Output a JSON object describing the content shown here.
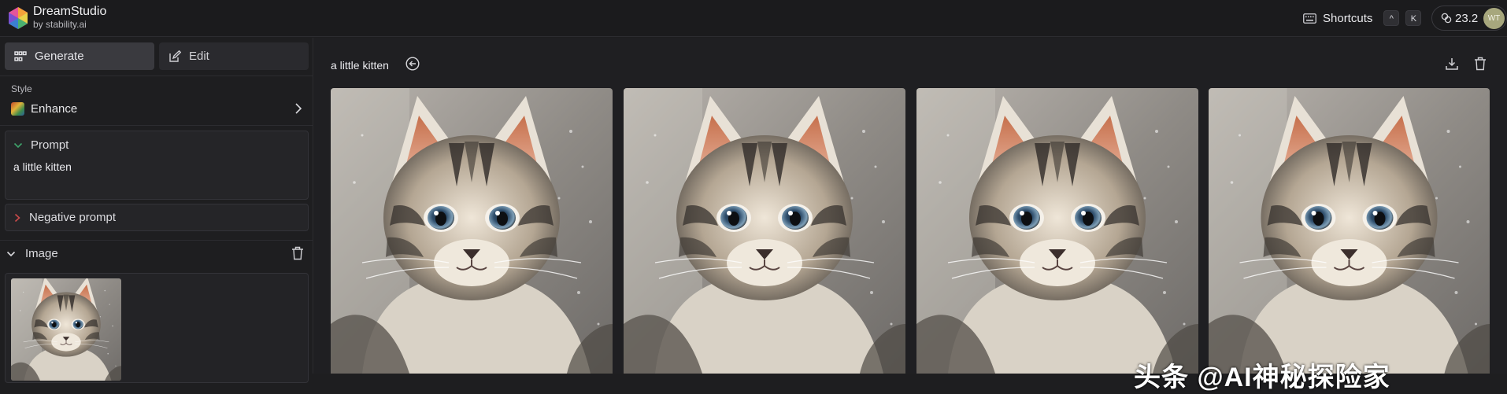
{
  "app": {
    "name": "DreamStudio",
    "subtitle": "by stability.ai"
  },
  "header": {
    "shortcuts_label": "Shortcuts",
    "shortcut_keys": [
      "^",
      "K"
    ],
    "credits": "23.2",
    "avatar_initials": "WT"
  },
  "sidebar": {
    "tabs": [
      {
        "label": "Generate",
        "icon": "grid-icon",
        "active": true
      },
      {
        "label": "Edit",
        "icon": "edit-icon",
        "active": false
      }
    ],
    "style": {
      "label": "Style",
      "value": "Enhance"
    },
    "prompt": {
      "label": "Prompt",
      "value": "a little kitten"
    },
    "negative_prompt": {
      "label": "Negative prompt"
    },
    "image": {
      "label": "Image"
    }
  },
  "main": {
    "prompt_title": "a little kitten",
    "image_count": 4
  },
  "watermark": "头条 @AI神秘探险家",
  "colors": {
    "accent_green": "#3fa36b",
    "accent_red": "#c94a4a",
    "avatar_bg": "#a7a77d"
  }
}
